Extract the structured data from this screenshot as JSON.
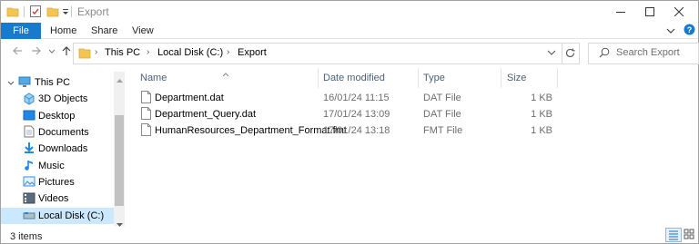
{
  "window": {
    "title": "Export"
  },
  "ribbon": {
    "file": "File",
    "home": "Home",
    "share": "Share",
    "view": "View"
  },
  "address": {
    "segments": [
      "This PC",
      "Local Disk (C:)",
      "Export"
    ],
    "search_placeholder": "Search Export"
  },
  "nav": {
    "items": [
      {
        "label": "This PC",
        "icon": "monitor-icon"
      },
      {
        "label": "3D Objects",
        "icon": "cube-icon"
      },
      {
        "label": "Desktop",
        "icon": "desktop-icon"
      },
      {
        "label": "Documents",
        "icon": "document-icon"
      },
      {
        "label": "Downloads",
        "icon": "download-icon"
      },
      {
        "label": "Music",
        "icon": "music-note-icon"
      },
      {
        "label": "Pictures",
        "icon": "picture-icon"
      },
      {
        "label": "Videos",
        "icon": "video-icon"
      },
      {
        "label": "Local Disk (C:)",
        "icon": "drive-icon",
        "selected": true
      }
    ]
  },
  "columns": {
    "name": "Name",
    "date": "Date modified",
    "type": "Type",
    "size": "Size"
  },
  "files": [
    {
      "name": "Department.dat",
      "date": "16/01/24 11:15",
      "type": "DAT File",
      "size": "1 KB"
    },
    {
      "name": "Department_Query.dat",
      "date": "17/01/24 13:09",
      "type": "DAT File",
      "size": "1 KB"
    },
    {
      "name": "HumanResources_Department_Format.fmt",
      "date": "17/01/24 13:18",
      "type": "FMT File",
      "size": "1 KB"
    }
  ],
  "status": {
    "count": "3 items"
  },
  "colors": {
    "accent": "#1979ca",
    "selection": "#cce8ff",
    "header_text": "#4c607a"
  }
}
